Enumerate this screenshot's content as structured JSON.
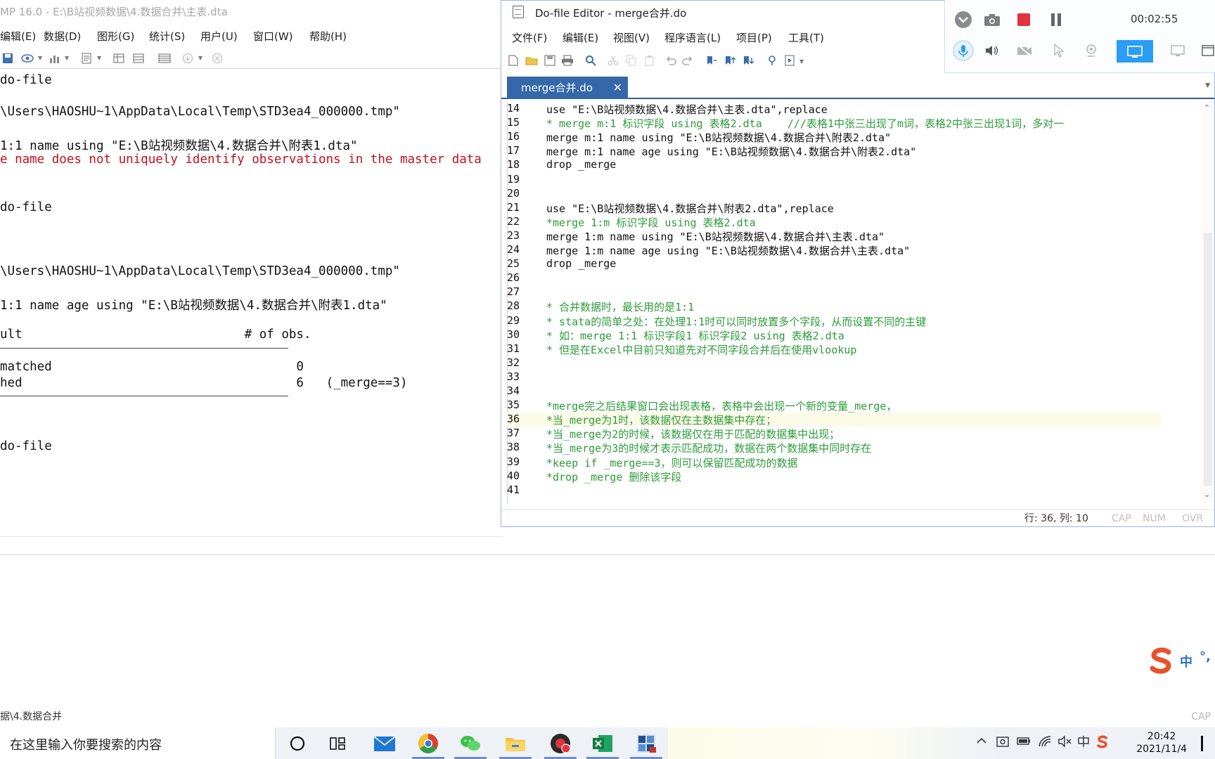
{
  "stata": {
    "title": "MP 16.0 - E:\\B站视频数据\\4.数据合并\\主表.dta",
    "menu": [
      "编辑(E)",
      "数据(D)",
      "图形(G)",
      "统计(S)",
      "用户(U)",
      "窗口(W)",
      "帮助(H)"
    ],
    "results": [
      "do-file",
      "\\Users\\HAOSHU~1\\AppData\\Local\\Temp\\STD3ea4_000000.tmp\"",
      "1:1 name using \"E:\\B站视频数据\\4.数据合并\\附表1.dta\"",
      "e name does not uniquely identify observations in the master data",
      "do-file",
      "\\Users\\HAOSHU~1\\AppData\\Local\\Temp\\STD3ea4_000000.tmp\"",
      "1:1 name age using \"E:\\B站视频数据\\4.数据合并\\附表1.dta\"",
      "ult                              # of obs.",
      "matched                                 0",
      "hed                                     6   (_merge==3)",
      "do-file"
    ],
    "status_path": "据\\4.数据合并",
    "status_cap": "CAP"
  },
  "editor": {
    "title": "Do-file Editor - merge合并.do",
    "menu": [
      "文件(F)",
      "编辑(E)",
      "视图(V)",
      "程序语言(L)",
      "项目(P)",
      "工具(T)"
    ],
    "tab_label": "merge合并.do",
    "tab_close": "✕",
    "line_numbers": [
      "14",
      "15",
      "16",
      "17",
      "18",
      "19",
      "20",
      "21",
      "22",
      "23",
      "24",
      "25",
      "26",
      "27",
      "28",
      "29",
      "30",
      "31",
      "32",
      "33",
      "34",
      "35",
      "36",
      "37",
      "38",
      "39",
      "40",
      "41"
    ],
    "code_lines": [
      "use \"E:\\B站视频数据\\4.数据合并\\主表.dta\",replace",
      "* merge m:1 标识字段 using 表格2.dta    ///表格1中张三出现了m词，表格2中张三出现1词，多对一",
      "merge m:1 name using \"E:\\B站视频数据\\4.数据合并\\附表2.dta\"",
      "merge m:1 name age using \"E:\\B站视频数据\\4.数据合并\\附表2.dta\"",
      "drop _merge",
      "",
      "",
      "use \"E:\\B站视频数据\\4.数据合并\\附表2.dta\",replace",
      "*merge 1:m 标识字段 using 表格2.dta",
      "merge 1:m name using \"E:\\B站视频数据\\4.数据合并\\主表.dta\"",
      "merge 1:m name age using \"E:\\B站视频数据\\4.数据合并\\主表.dta\"",
      "drop _merge",
      "",
      "",
      "* 合并数据时，最长用的是1:1",
      "* stata的简单之处：在处理1:1时可以同时放置多个字段，从而设置不同的主键",
      "* 如：merge 1:1 标识字段1 标识字段2 using 表格2.dta",
      "* 但是在Excel中目前只知道先对不同字段合并后在使用vlookup",
      "",
      "",
      "",
      "*merge完之后结果窗口会出现表格，表格中会出现一个新的变量_merge，",
      "*当_merge为1时，该数据仅在主数据集中存在；",
      "*当_merge为2的时候，该数据仅在用于匹配的数据集中出现；",
      "*当_merge为3的时候才表示匹配成功，数据在两个数据集中同时存在",
      "*keep if _merge==3，则可以保留匹配成功的数据",
      "*drop _merge 删除该字段",
      ""
    ],
    "status": {
      "position": "行: 36, 列: 10",
      "cap": "CAP",
      "num": "NUM",
      "ovr": "OVR"
    }
  },
  "recorder": {
    "timer": "00:02:55"
  },
  "ime": {
    "lang": "中"
  },
  "taskbar": {
    "search_placeholder": "在这里输入你要搜索的内容",
    "clock_time": "20:42",
    "clock_date": "2021/11/4"
  },
  "colors": {
    "comment": "#2d9c3a",
    "error": "#c0101e",
    "tab_active": "#3568a8",
    "recorder_accent": "#2a9df4",
    "record_button": "#e0343c"
  }
}
